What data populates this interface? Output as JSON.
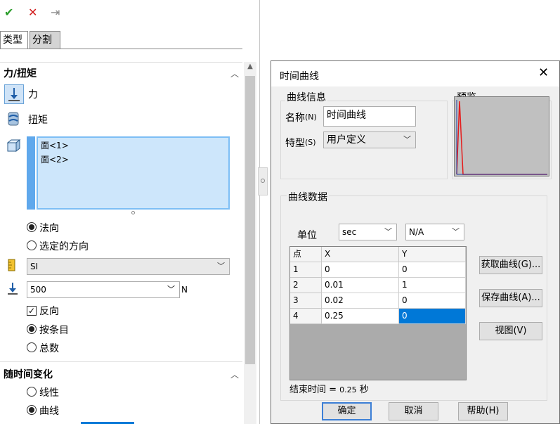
{
  "toolbar": {
    "ok_glyph": "✔",
    "cancel_glyph": "✕",
    "pin_glyph": "⇥"
  },
  "tabs": [
    {
      "label": "类型"
    },
    {
      "label": "分割"
    }
  ],
  "force_group": {
    "title": "力/扭矩",
    "force_label": "力",
    "torque_label": "扭矩",
    "faces": [
      "面<1>",
      "面<2>"
    ],
    "normal_label": "法向",
    "selected_direction_label": "选定的方向",
    "unit_system": "SI",
    "magnitude": "500",
    "magnitude_unit": "N",
    "reverse_label": "反向",
    "reverse_checked": true,
    "per_item_label": "按条目",
    "total_label": "总数"
  },
  "time_group": {
    "title": "随时间变化",
    "linear_label": "线性",
    "curve_label": "曲线"
  },
  "dialog": {
    "title": "时间曲线",
    "info_group": "曲线信息",
    "name_label": "名称",
    "name_hotkey": "(N)",
    "name_value": "时间曲线",
    "type_label": "特型",
    "type_hotkey": "(S)",
    "type_value": "用户定义",
    "preview_group": "预览",
    "data_group": "曲线数据",
    "unit_label": "单位",
    "unit_x": "sec",
    "unit_y": "N/A",
    "table": {
      "headers": [
        "点",
        "X",
        "Y"
      ],
      "rows": [
        [
          "1",
          "0",
          "0"
        ],
        [
          "2",
          "0.01",
          "1"
        ],
        [
          "3",
          "0.02",
          "0"
        ],
        [
          "4",
          "0.25",
          "0"
        ]
      ]
    },
    "end_time_label": "结束时间 = ",
    "end_time_value": "0.25",
    "end_time_unit": " 秒",
    "get_curve_button": "获取曲线(G)...",
    "save_curve_button": "保存曲线(A)...",
    "view_button": "视图(V)",
    "ok_button": "确定",
    "cancel_button": "取消",
    "help_button": "帮助(H)"
  },
  "colors": {
    "accent": "#0078d7",
    "ok_green": "#2a9d2a",
    "cancel_red": "#d11b1b",
    "curve_red": "#e51c1c"
  }
}
